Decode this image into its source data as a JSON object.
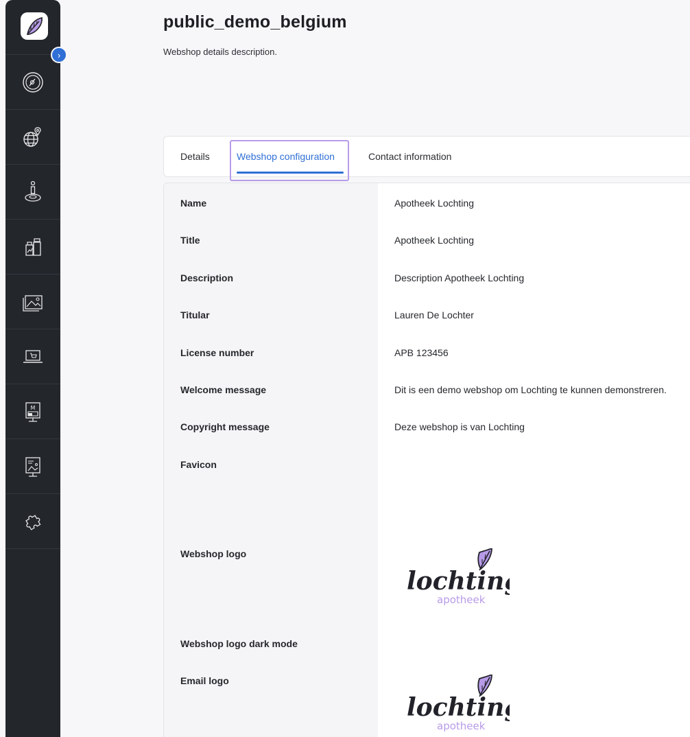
{
  "page": {
    "title": "public_demo_belgium",
    "description": "Webshop details description."
  },
  "sidebar": {
    "items": [
      {
        "icon": "dashboard-gauge-icon"
      },
      {
        "icon": "globe-location-icon"
      },
      {
        "icon": "person-pin-icon"
      },
      {
        "icon": "products-icon"
      },
      {
        "icon": "image-gallery-icon"
      },
      {
        "icon": "webshop-laptop-icon"
      },
      {
        "icon": "monitor-m-icon"
      },
      {
        "icon": "display-screen-icon"
      },
      {
        "icon": "puzzle-plugin-icon"
      }
    ]
  },
  "tabs": [
    {
      "label": "Details",
      "active": false
    },
    {
      "label": "Webshop configuration",
      "active": true
    },
    {
      "label": "Contact information",
      "active": false
    }
  ],
  "details": {
    "rows": [
      {
        "label": "Name",
        "value": "Apotheek Lochting"
      },
      {
        "label": "Title",
        "value": "Apotheek Lochting"
      },
      {
        "label": "Description",
        "value": "Description Apotheek Lochting"
      },
      {
        "label": "Titular",
        "value": "Lauren De Lochter"
      },
      {
        "label": "License number",
        "value": "APB 123456"
      },
      {
        "label": "Welcome message",
        "value": "Dit is een demo webshop om Lochting te kunnen demonstreren."
      },
      {
        "label": "Copyright message",
        "value": "Deze webshop is van Lochting"
      },
      {
        "label": "Favicon",
        "value": ""
      },
      {
        "label": "Webshop logo",
        "value": ""
      },
      {
        "label": "Webshop logo dark mode",
        "value": ""
      },
      {
        "label": "Email logo",
        "value": ""
      }
    ],
    "logo_text": "lochting",
    "logo_subtext": "apotheek"
  },
  "colors": {
    "accent": "#2f6fd6",
    "highlight": "#b89be8",
    "sidebar": "#23262b",
    "logo_purple": "#b89be8",
    "logo_dark": "#22232a"
  }
}
